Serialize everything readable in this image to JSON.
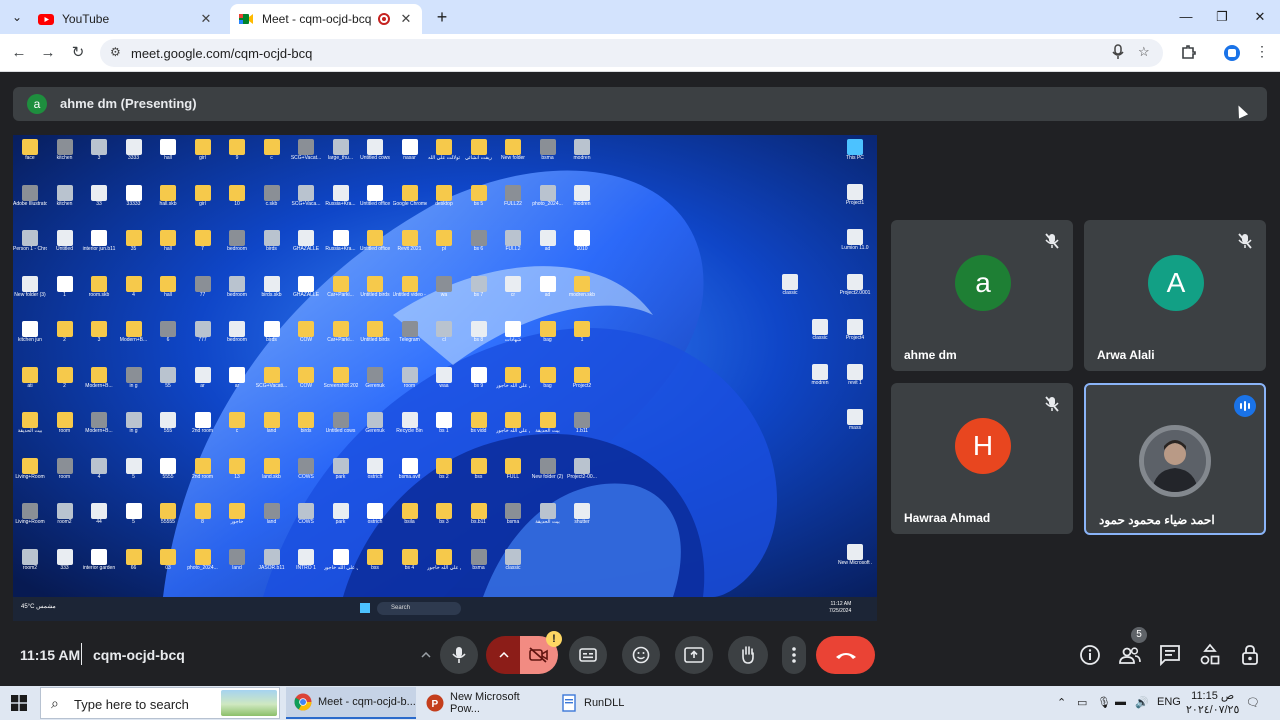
{
  "browser": {
    "tabs": [
      {
        "title": "YouTube",
        "active": false
      },
      {
        "title": "Meet - cqm-ocjd-bcq",
        "active": true
      }
    ],
    "url": "meet.google.com/cqm-ocjd-bcq",
    "window_controls": {
      "minimize": "—",
      "restore": "❐",
      "close": "✕"
    }
  },
  "meet": {
    "presenting_label": "ahme dm (Presenting)",
    "presenter_initial": "a",
    "time": "11:15 AM",
    "meeting_code": "cqm-ocjd-bcq",
    "people_count": "5",
    "warning_badge": "!",
    "participants": [
      {
        "name": "ahme dm",
        "initial": "a",
        "color": "#1e7f34",
        "muted": true
      },
      {
        "name": "Arwa Alali",
        "initial": "A",
        "color": "#12a085",
        "muted": true
      },
      {
        "name": "Hawraa Ahmad",
        "initial": "H",
        "color": "#e8461f",
        "muted": true
      },
      {
        "name": "احمد ضياء محمود حمود",
        "initial": "",
        "color": "#6d7278",
        "muted": false,
        "speaking": true
      }
    ]
  },
  "shared_screen": {
    "desktop_icons": [
      "face",
      "kitchen",
      "3",
      "3333",
      "hall",
      "girl",
      "9",
      "c",
      "SCG+Vacat...",
      "large_thu...",
      "Untitled cows",
      "nasar",
      "تولالت علي الله",
      "ريفت انشائي",
      "New folder",
      "bsma",
      "modren",
      "Adobe Illustrator...",
      "kitchen",
      "33",
      "33333",
      "hall.skb",
      "girl",
      "10",
      "c.skb",
      "SCG+Vaca...",
      "Russia+Kra...",
      "Untitled office",
      "Google Chrome",
      "desktop",
      "bs 5",
      "FULL22",
      "photo_2024...",
      "modren",
      "Person 1 - Chrome",
      "Untitled",
      "interior jun.b11",
      "35",
      "hall",
      "7",
      "bedroom",
      "birds",
      "GHAZALLE",
      "Russia+Kra...",
      "Untitled office",
      "Revit 2021",
      "pl",
      "bs 6",
      "FULL2",
      "ad",
      "1010",
      "New folder (3)",
      "1",
      "room.skb",
      "4",
      "hall",
      "77",
      "bedroom",
      "birds.skb",
      "GHAZALLE",
      "Car+Parki...",
      "Untitled birds",
      "Untitled video - Ma...",
      "wa",
      "bs 7",
      "cr",
      "ad",
      "modren.skb",
      "kitchen jun",
      "2",
      "3",
      "Modern+B...",
      "6",
      "777",
      "bedroom",
      "birds",
      "COW",
      "Car+Parki...",
      "Untitled birds",
      "Telegram",
      "cl",
      "bs 8",
      "شهادات",
      "bag",
      "1",
      "ati",
      "2",
      "Modern+B...",
      "in g",
      "55",
      "ar",
      "ar",
      "SCG+Vacati...",
      "COW",
      "Screenshot 2024-01...",
      "Gerenuk",
      "room",
      "waa",
      "bs 9",
      "انا متوكل علي الله خاجور",
      "bag",
      "Project2",
      "بيت الحديقة",
      "room",
      "Modern+B...",
      "in g",
      "555",
      "2nd room",
      "c",
      "land",
      "birds",
      "Untitled cows",
      "Gerenuk",
      "Recycle Bin",
      "bs 1",
      "bs vidd",
      "انا متوكل علي الله خاجور.skb",
      "بيت الحديقة",
      "1.b11",
      "Living+Room",
      "room",
      "4",
      "5",
      "5555",
      "2nd room",
      "13",
      "land.skb",
      "COWS",
      "park",
      "ostrich",
      "bsma.avif",
      "bs 2",
      "bss",
      "FULL",
      "New folder (2)",
      "Project2-00...",
      "Living+Room",
      "room2",
      "44",
      "5",
      "55555",
      "8",
      "خاجور",
      "land",
      "COWS",
      "park",
      "ostrich",
      "bsila",
      "bs 3",
      "bs.b11",
      "bsma",
      "بيت الحديقة",
      "shutter",
      "room2",
      "333",
      "interior garden",
      "66",
      "03",
      "photo_2024...",
      "land",
      "JASOR.b11",
      "INTRO 1",
      "انا متوكل علي الله خاجور",
      "bss",
      "bs 4",
      "انا متوكل علي الله خاجور.dwg",
      "bsma",
      "classic"
    ],
    "right_icons": [
      "This PC",
      "Project1",
      "Lumion 11.0",
      "Project2.0001",
      "classic",
      "Project4",
      "classic",
      "revit 1",
      "modren",
      "mass",
      "New Microsoft ..."
    ],
    "taskbar_weather": "45°C مشمس",
    "taskbar_search": "Search",
    "taskbar_time": "11:12 AM",
    "taskbar_date": "7/25/2024"
  },
  "windows_taskbar": {
    "search_placeholder": "Type here to search",
    "apps": [
      {
        "label": "Meet - cqm-ocjd-b...",
        "icon_color": "#4285f4",
        "active": true
      },
      {
        "label": "New Microsoft Pow...",
        "icon_color": "#c43e1c",
        "active": false
      },
      {
        "label": "RunDLL",
        "icon_color": "#3b78d8",
        "active": false
      }
    ],
    "language": "ENG",
    "clock_time": "11:15 ص",
    "clock_date": "٢٠٢٤/٠٧/٢٥"
  }
}
